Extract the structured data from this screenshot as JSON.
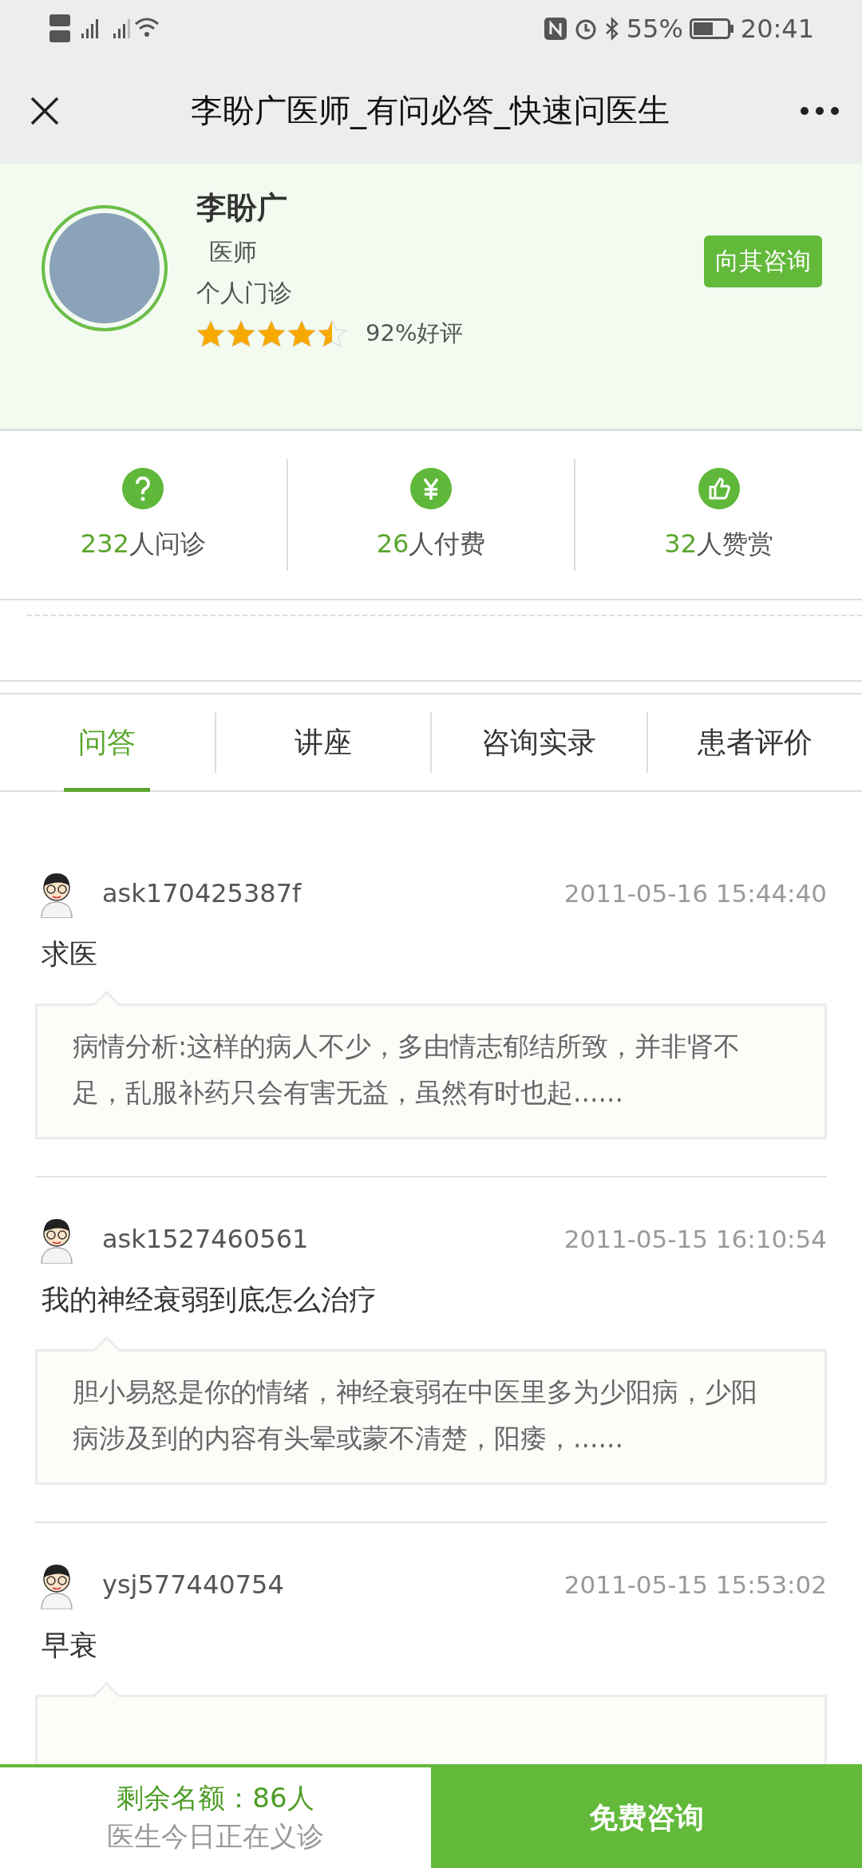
{
  "status_bar": {
    "battery": "55%",
    "time": "20:41"
  },
  "window": {
    "title": "李盼广医师_有问必答_快速问医生"
  },
  "doctor": {
    "name": "李盼广",
    "title": "医师",
    "clinic": "个人门诊",
    "stars": 4.5,
    "rating": "92%好评",
    "consult_button": "向其咨询"
  },
  "stats": [
    {
      "kind": "question",
      "count": "232",
      "label": "人问诊"
    },
    {
      "kind": "fee",
      "count": "26",
      "label": "人付费"
    },
    {
      "kind": "like",
      "count": "32",
      "label": "人赞赏"
    }
  ],
  "tabs": [
    {
      "label": "问答",
      "selected": true
    },
    {
      "label": "讲座",
      "selected": false
    },
    {
      "label": "咨询实录",
      "selected": false
    },
    {
      "label": "患者评价",
      "selected": false
    }
  ],
  "questions": [
    {
      "user": "ask170425387f",
      "time": "2011-05-16 15:44:40",
      "title": "求医",
      "answer": "病情分析:这样的病人不少，多由情志郁结所致，并非肾不足，乱服补药只会有害无益，虽然有时也起......"
    },
    {
      "user": "ask1527460561",
      "time": "2011-05-15 16:10:54",
      "title": "我的神经衰弱到底怎么治疗",
      "answer": "胆小易怒是你的情绪，神经衰弱在中医里多为少阳病，少阳病涉及到的内容有头晕或蒙不清楚，阳痿，......"
    },
    {
      "user": "ysj577440754",
      "time": "2011-05-15 15:53:02",
      "title": "早衰"
    }
  ],
  "bottom_bar": {
    "quota": "剩余名额：86人",
    "note": "医生今日正在义诊",
    "button": "免费咨询"
  }
}
